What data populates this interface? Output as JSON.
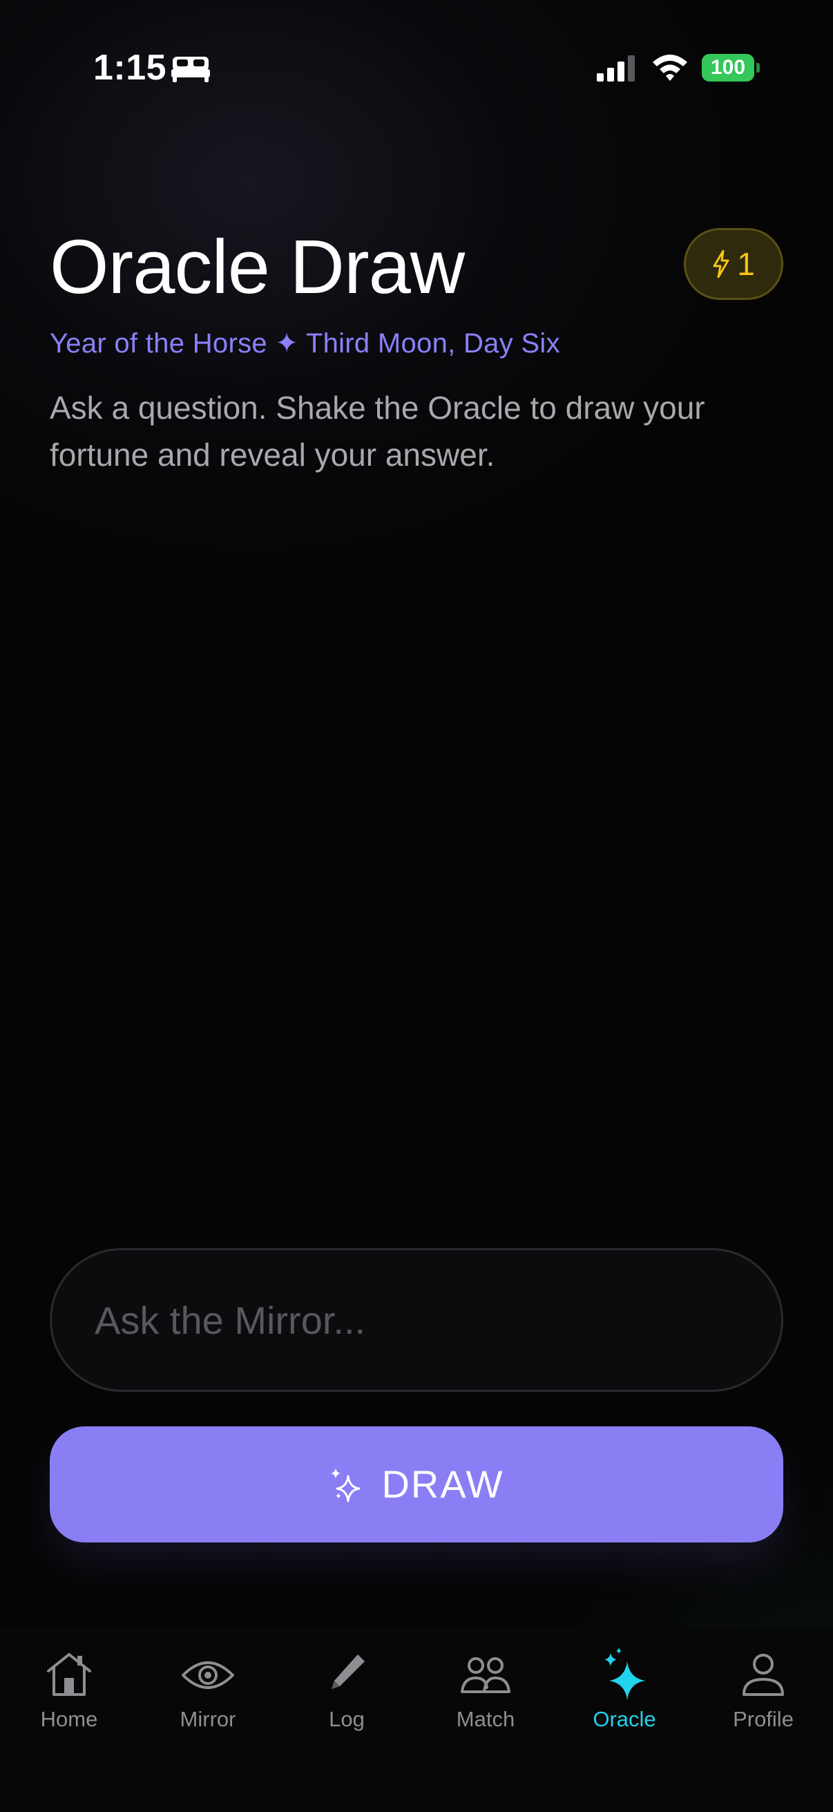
{
  "status_bar": {
    "time": "1:15",
    "battery": "100",
    "icons": [
      "bed-icon",
      "signal-icon",
      "wifi-icon",
      "battery-icon"
    ]
  },
  "header": {
    "title": "Oracle Draw",
    "energy_count": "1",
    "energy_icon": "bolt-icon",
    "lunar_date": "Year of the Horse ✦ Third Moon, Day Six",
    "instructions": "Ask a question. Shake the Oracle to draw your fortune and reveal your answer."
  },
  "question": {
    "placeholder": "Ask the Mirror...",
    "value": ""
  },
  "draw_button": {
    "label": "DRAW",
    "icon": "sparkle-icon"
  },
  "tabs": [
    {
      "label": "Home",
      "icon": "home-icon",
      "active": false
    },
    {
      "label": "Mirror",
      "icon": "eye-icon",
      "active": false
    },
    {
      "label": "Log",
      "icon": "pencil-icon",
      "active": false
    },
    {
      "label": "Match",
      "icon": "people-icon",
      "active": false
    },
    {
      "label": "Oracle",
      "icon": "sparkle-icon",
      "active": true
    },
    {
      "label": "Profile",
      "icon": "person-icon",
      "active": false
    }
  ],
  "colors": {
    "accent": "#8a7ef5",
    "lunar_text": "#8b80f9",
    "active_tab": "#22d3ee",
    "energy": "#f5c518",
    "battery": "#34c759"
  }
}
